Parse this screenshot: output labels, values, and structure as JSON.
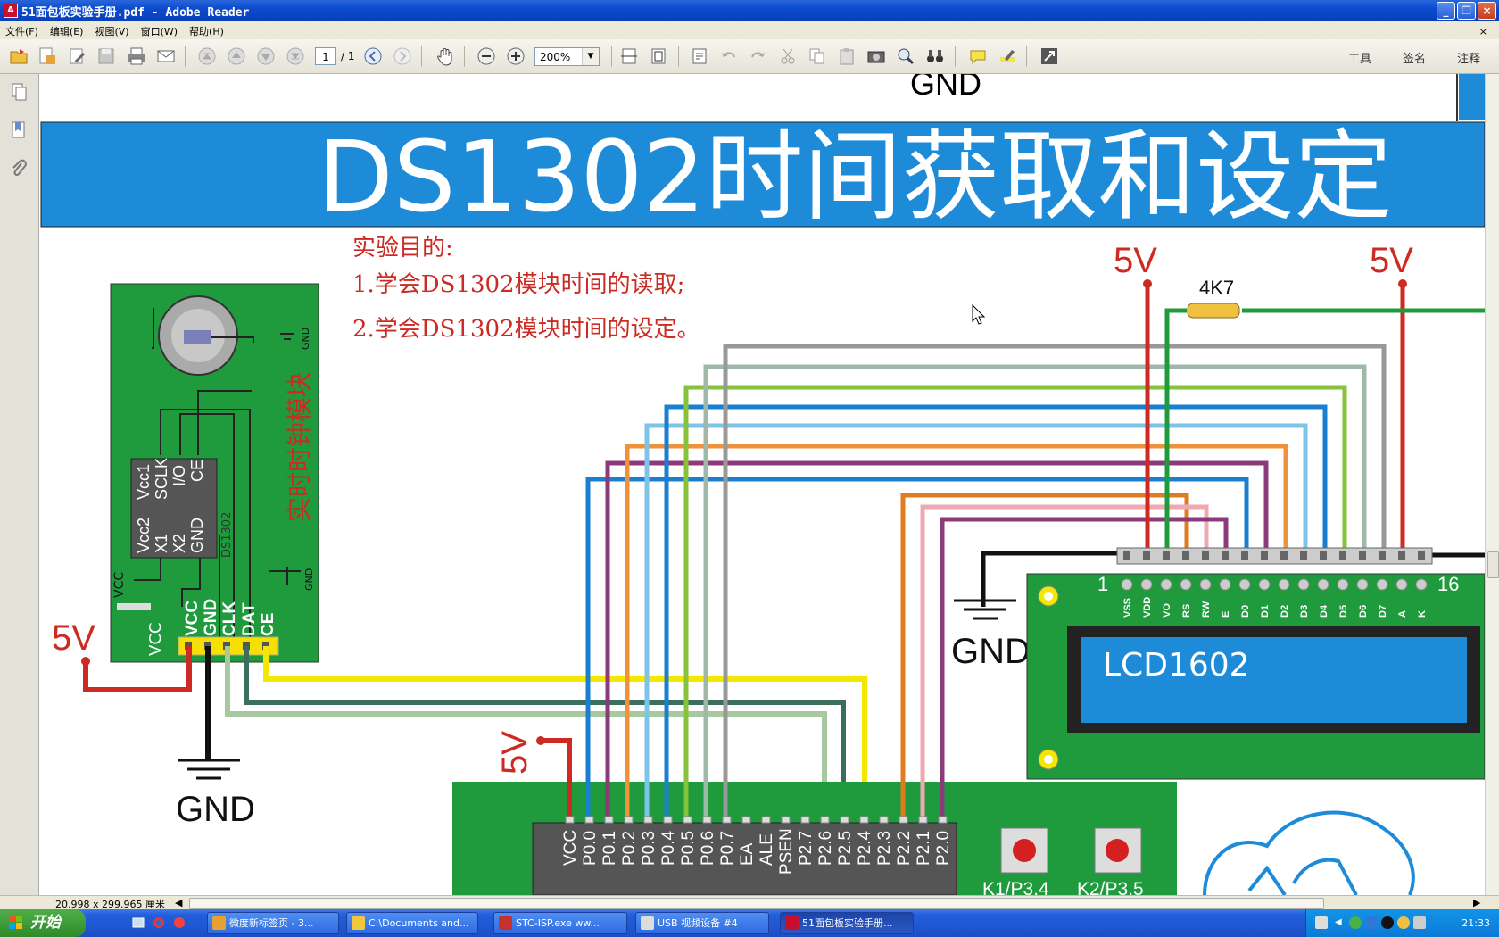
{
  "window": {
    "title": "51面包板实验手册.pdf - Adobe Reader",
    "app_icon_letter": "A"
  },
  "menu": {
    "items": [
      "文件(F)",
      "编辑(E)",
      "视图(V)",
      "窗口(W)",
      "帮助(H)"
    ],
    "close_glyph": "×"
  },
  "toolbar": {
    "page_current": "1",
    "page_total": "/ 1",
    "zoom": "200%",
    "right_tools": [
      "工具",
      "签名",
      "注释"
    ]
  },
  "status": {
    "dimensions": "20.998 x 299.965 厘米"
  },
  "document": {
    "top_gnd": "GND",
    "banner_title": "DS1302时间获取和设定",
    "purpose_title": "实验目的:",
    "purpose_1": "1.学会DS1302模块时间的读取;",
    "purpose_2": "2.学会DS1302模块时间的设定。",
    "module_label": "实时时钟模块",
    "chip_name": "DS1302",
    "chip_pins_top": [
      "Vcc1",
      "SCLK",
      "I/O",
      "CE"
    ],
    "chip_pins_bottom": [
      "Vcc2",
      "X1",
      "X2",
      "GND"
    ],
    "module_gnd_small": "GND",
    "module_vcc_small": "VCC",
    "module_header": [
      "VCC",
      "GND",
      "CLK",
      "DAT",
      "CE"
    ],
    "vcc_left": "VCC",
    "v5_left": "5V",
    "gnd_left": "GND",
    "v5_lcd_left": "5V",
    "v5_lcd_right": "5V",
    "resistor": "4K7",
    "gnd_lcd": "GND",
    "lcd_name": "LCD1602",
    "lcd_pin_first": "1",
    "lcd_pin_last": "16",
    "lcd_pins": [
      "VSS",
      "VDD",
      "VO",
      "RS",
      "RW",
      "E",
      "D0",
      "D1",
      "D2",
      "D3",
      "D4",
      "D5",
      "D6",
      "D7",
      "A",
      "K"
    ],
    "v5_mcu": "5V",
    "mcu_pins": [
      "VCC",
      "P0.0",
      "P0.1",
      "P0.2",
      "P0.3",
      "P0.4",
      "P0.5",
      "P0.6",
      "P0.7",
      "EA",
      "ALE",
      "PSEN",
      "P2.7",
      "P2.6",
      "P2.5",
      "P2.4",
      "P2.3",
      "P2.2",
      "P2.1",
      "P2.0"
    ],
    "button_k1": "K1/P3.4",
    "button_k2": "K2/P3.5"
  },
  "taskbar": {
    "start": "开始",
    "tasks": [
      "微度新标签页 - 3...",
      "C:\\Documents and...",
      "STC-ISP.exe    ww...",
      "USB 视频设备 #4",
      "51面包板实验手册..."
    ],
    "clock": "21:33"
  },
  "colors": {
    "banner_blue": "#1e8bd9",
    "pcb_green": "#1f9a3c",
    "label_red": "#cc2a22"
  }
}
